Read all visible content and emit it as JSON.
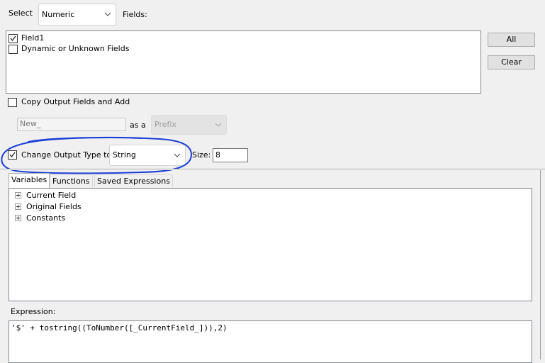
{
  "select_row": {
    "select_label": "Select",
    "type_value": "Numeric",
    "fields_label": "Fields:"
  },
  "fields_list": [
    {
      "label": "Field1",
      "checked": true
    },
    {
      "label": "Dynamic or Unknown Fields",
      "checked": false
    }
  ],
  "buttons": {
    "all": "All",
    "clear": "Clear"
  },
  "copy_output": {
    "label": "Copy Output Fields and Add",
    "checked": false,
    "text_value": "New_",
    "as_a_label": "as a",
    "position_value": "Prefix"
  },
  "change_output": {
    "label": "Change Output Type to",
    "checked": true,
    "type_value": "String",
    "size_label": "Size:",
    "size_value": "8"
  },
  "tabs": [
    "Variables",
    "Functions",
    "Saved Expressions"
  ],
  "tree": [
    "Current Field",
    "Original Fields",
    "Constants"
  ],
  "expression": {
    "label": "Expression:",
    "value": "'$' + tostring((ToNumber([_CurrentField_])),2)"
  },
  "colors": {
    "annotation": "#1a3fd6"
  }
}
